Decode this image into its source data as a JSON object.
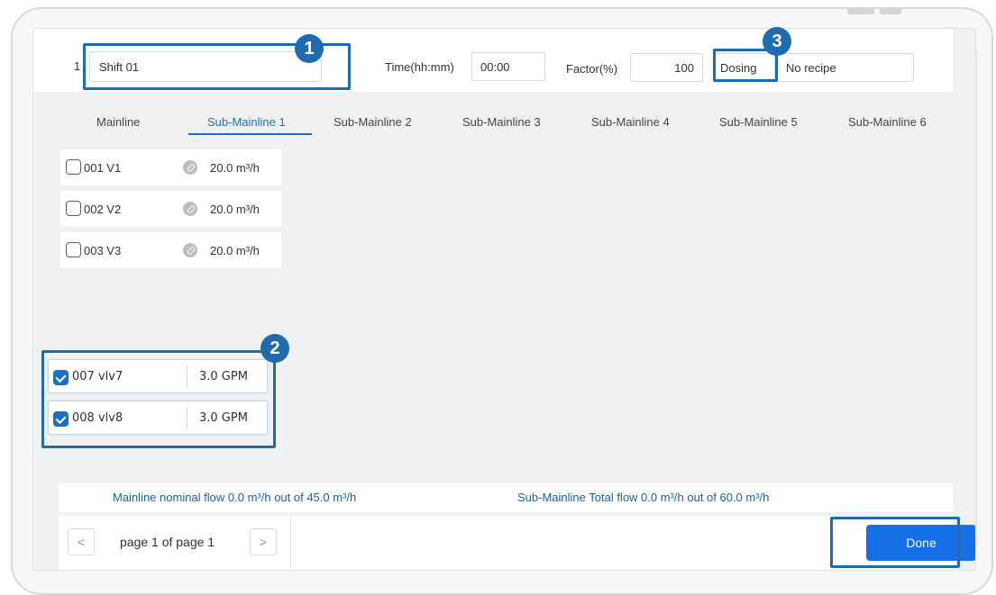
{
  "header": {
    "row_number": "1",
    "shift_name": "Shift 01",
    "time_label": "Time(hh:mm)",
    "time_value": "00:00",
    "factor_label": "Factor(%)",
    "factor_value": "100",
    "dosing_label": "Dosing",
    "recipe_value": "No recipe"
  },
  "tabs": [
    {
      "label": "Mainline",
      "active": false
    },
    {
      "label": "Sub-Mainline 1",
      "active": true
    },
    {
      "label": "Sub-Mainline 2",
      "active": false
    },
    {
      "label": "Sub-Mainline 3",
      "active": false
    },
    {
      "label": "Sub-Mainline 4",
      "active": false
    },
    {
      "label": "Sub-Mainline 5",
      "active": false
    },
    {
      "label": "Sub-Mainline 6",
      "active": false
    }
  ],
  "valves": [
    {
      "name": "001  V1",
      "flow": "20.0 m³/h",
      "checked": false
    },
    {
      "name": "002  V2",
      "flow": "20.0 m³/h",
      "checked": false
    },
    {
      "name": "003  V3",
      "flow": "20.0 m³/h",
      "checked": false
    }
  ],
  "selected_valves": [
    {
      "name": "007 vlv7",
      "flow": "3.0 GPM",
      "checked": true
    },
    {
      "name": "008 vlv8",
      "flow": "3.0 GPM",
      "checked": true
    }
  ],
  "summary": {
    "mainline": "Mainline nominal flow 0.0 m³/h out of 45.0 m³/h",
    "submainline": "Sub-Mainline Total flow 0.0 m³/h out of 60.0 m³/h"
  },
  "pagination": {
    "prev": "<",
    "text": "page 1 of page 1",
    "next": ">"
  },
  "done_label": "Done",
  "annotations": {
    "one": "1",
    "two": "2",
    "three": "3"
  },
  "colors": {
    "accent": "#1672c7",
    "annotation": "#1f6bb0",
    "done_button": "#1670e5"
  }
}
